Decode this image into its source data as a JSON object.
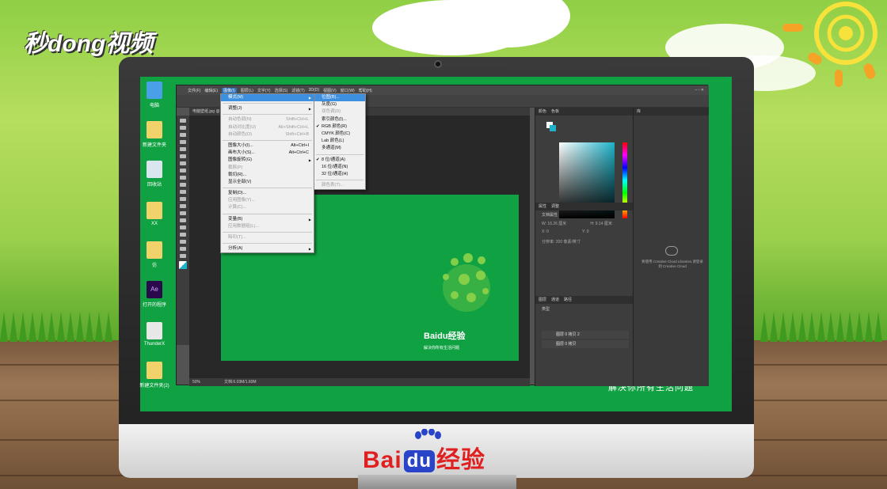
{
  "watermark": {
    "logo": "秒dong视频"
  },
  "bottom_brand": {
    "bai": "Bai",
    "du": "du",
    "jingyan": "经验"
  },
  "desktop_icons": [
    {
      "label": "电脑"
    },
    {
      "label": "新建文件夹"
    },
    {
      "label": "回收站"
    },
    {
      "label": "XX"
    },
    {
      "label": "仿"
    },
    {
      "label": "打开的程序"
    },
    {
      "label": "ThunderX"
    },
    {
      "label": "新建文件夹(2)"
    }
  ],
  "photoshop": {
    "menubar": [
      "文件(F)",
      "编辑(E)",
      "图像(I)",
      "图层(L)",
      "文字(Y)",
      "选择(S)",
      "滤镜(T)",
      "3D(D)",
      "视图(V)",
      "窗口(W)",
      "帮助(H)"
    ],
    "doc_tab": "电脑壁纸.jpg @ 50%",
    "status_zoom": "50%",
    "status_doc": "文档:6.03M/1.60M",
    "canvas_brand": "Baidu经验",
    "canvas_slogan": "解决你所有生活问题",
    "panel_color_tabs": [
      "颜色",
      "色板"
    ],
    "panel_props_tabs": [
      "属性",
      "调整"
    ],
    "props_title": "文档属性",
    "props_w": "W: 16.26 厘米",
    "props_h": "H: 9.14 厘米",
    "props_x": "X: 0",
    "props_y": "Y: 0",
    "props_res": "分辨率: 200 像素/英寸",
    "panel_layers_tabs": [
      "图层",
      "通道",
      "路径"
    ],
    "layers_filter": "类型",
    "layers": [
      "图层 0 拷贝 2",
      "图层 0 拷贝"
    ],
    "panel_lib_tab": "库",
    "lib_note": "要使用 Creative Cloud Libraries,请登录到 Creative Cloud"
  },
  "image_menu": {
    "items": [
      {
        "label": "模式(M)",
        "sc": "",
        "state": "hl",
        "arrow": true
      },
      {
        "sep": true
      },
      {
        "label": "调整(J)",
        "sc": "",
        "state": "",
        "arrow": true
      },
      {
        "sep": true
      },
      {
        "label": "自动色调(N)",
        "sc": "Shift+Ctrl+L",
        "state": "dis"
      },
      {
        "label": "自动对比度(U)",
        "sc": "Alt+Shift+Ctrl+L",
        "state": "dis"
      },
      {
        "label": "自动颜色(O)",
        "sc": "Shift+Ctrl+B",
        "state": "dis"
      },
      {
        "sep": true
      },
      {
        "label": "图像大小(I)...",
        "sc": "Alt+Ctrl+I",
        "state": ""
      },
      {
        "label": "画布大小(S)...",
        "sc": "Alt+Ctrl+C",
        "state": ""
      },
      {
        "label": "图像旋转(G)",
        "sc": "",
        "state": "",
        "arrow": true
      },
      {
        "label": "裁剪(P)",
        "sc": "",
        "state": "dis"
      },
      {
        "label": "裁切(R)...",
        "sc": "",
        "state": ""
      },
      {
        "label": "显示全部(V)",
        "sc": "",
        "state": ""
      },
      {
        "sep": true
      },
      {
        "label": "复制(D)...",
        "sc": "",
        "state": ""
      },
      {
        "label": "应用图像(Y)...",
        "sc": "",
        "state": "dis"
      },
      {
        "label": "计算(C)...",
        "sc": "",
        "state": "dis"
      },
      {
        "sep": true
      },
      {
        "label": "变量(B)",
        "sc": "",
        "state": "",
        "arrow": true
      },
      {
        "label": "应用数据组(L)...",
        "sc": "",
        "state": "dis"
      },
      {
        "sep": true
      },
      {
        "label": "陷印(T)...",
        "sc": "",
        "state": "dis"
      },
      {
        "sep": true
      },
      {
        "label": "分析(A)",
        "sc": "",
        "state": "",
        "arrow": true
      }
    ]
  },
  "mode_menu": {
    "items": [
      {
        "label": "位图(B)...",
        "state": "hl",
        "check": ""
      },
      {
        "label": "灰度(G)",
        "state": "",
        "check": ""
      },
      {
        "label": "双色调(D)",
        "state": "dis",
        "check": ""
      },
      {
        "label": "索引颜色(I)...",
        "state": "",
        "check": ""
      },
      {
        "label": "RGB 颜色(R)",
        "state": "",
        "check": "✔"
      },
      {
        "label": "CMYK 颜色(C)",
        "state": "",
        "check": ""
      },
      {
        "label": "Lab 颜色(L)",
        "state": "",
        "check": ""
      },
      {
        "label": "多通道(M)",
        "state": "",
        "check": ""
      },
      {
        "sep": true
      },
      {
        "label": "8 位/通道(A)",
        "state": "",
        "check": "✔"
      },
      {
        "label": "16 位/通道(N)",
        "state": "",
        "check": ""
      },
      {
        "label": "32 位/通道(H)",
        "state": "",
        "check": ""
      },
      {
        "sep": true
      },
      {
        "label": "颜色表(T)...",
        "state": "dis",
        "check": ""
      }
    ]
  },
  "screen_slogan": "解决你所有生活问题"
}
